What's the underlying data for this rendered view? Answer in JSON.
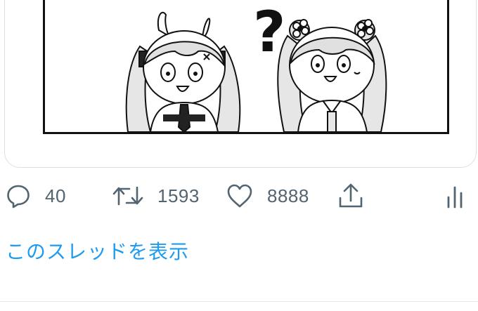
{
  "tweet": {
    "media": {
      "alt": "monochrome comic panel of two girls with a question mark",
      "glyph": "?"
    },
    "actions": {
      "reply": {
        "icon": "reply-bubble-icon",
        "count": "40"
      },
      "retweet": {
        "icon": "retweet-arrows-icon",
        "count": "1593"
      },
      "like": {
        "icon": "heart-icon",
        "count": "8888"
      },
      "share": {
        "icon": "share-upload-icon"
      },
      "analytics": {
        "icon": "bar-chart-icon"
      }
    },
    "show_thread_label": "このスレッドを表示"
  },
  "colors": {
    "icon_gray": "#536471",
    "link_blue": "#1d9bf0",
    "border": "#dcdfe3"
  }
}
